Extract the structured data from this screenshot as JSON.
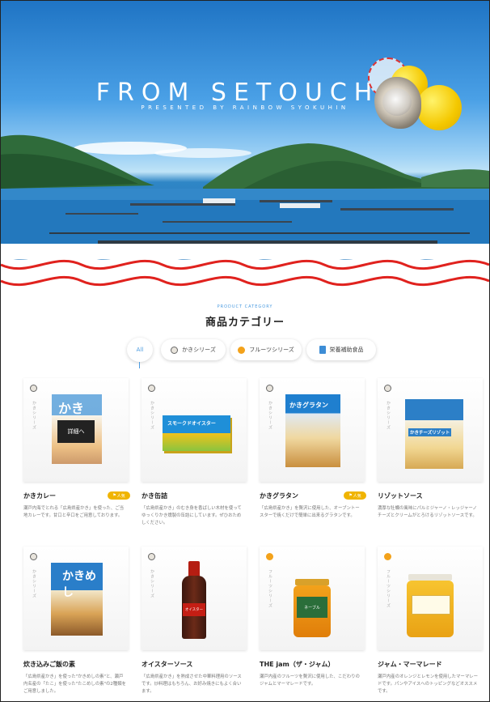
{
  "hero": {
    "title": "FROM SETOUCHI",
    "subtitle": "PRESENTED BY RAINBOW SYOKUHIN"
  },
  "category": {
    "eyebrow": "PRODUCT CATEGORY",
    "title": "商品カテゴリー"
  },
  "filters": [
    {
      "label": "All",
      "icon": "none",
      "active": true
    },
    {
      "label": "かきシリーズ",
      "icon": "oyster-shell-icon"
    },
    {
      "label": "フルーツシリーズ",
      "icon": "fruit-icon"
    },
    {
      "label": "栄養補助食品",
      "icon": "package-icon"
    }
  ],
  "products": [
    {
      "name": "かきカレー",
      "badge": "人気",
      "detail_button": "詳細へ",
      "series": "かきシリーズ",
      "desc": "瀬戸内海でとれる「広島県産かき」を使った、ご当地カレーです。甘口と辛口をご用意しております。"
    },
    {
      "name": "かき缶詰",
      "badge": "",
      "series": "かきシリーズ",
      "desc": "「広島県産かき」のむき身を香ばしい木材を使ってゆっくりかき燻製の缶詰にしています。ぜひおためしください。"
    },
    {
      "name": "かきグラタン",
      "badge": "人気",
      "series": "かきシリーズ",
      "desc": "「広島県産かき」を贅沢に使用した、オーブントースターで焼くだけで簡単に出来るグラタンです。"
    },
    {
      "name": "リゾットソース",
      "badge": "",
      "series": "かきシリーズ",
      "desc": "濃厚な牡蠣の風味にパルミジャーノ・レッジャーノチーズとクリームがとろけるリゾットソースです。"
    },
    {
      "name": "炊き込みご飯の素",
      "badge": "",
      "series": "かきシリーズ",
      "desc": "「広島県産かき」を使った\"かきめしの素\"と、瀬戸内名産の「たこ」を使った\"たこめしの素\"の2種類をご用意しました。"
    },
    {
      "name": "オイスターソース",
      "badge": "",
      "series": "かきシリーズ",
      "desc": "「広島県産かき」を熟成させた中華料理用のソースです。炒料理はもちろん、お好み焼きにもよく合います。"
    },
    {
      "name": "THE jam（ザ・ジャム）",
      "badge": "",
      "series": "フルーツシリーズ",
      "desc": "瀬戸内産のフルーツを贅沢に使用した、こだわりのジャムとマーマレードです。"
    },
    {
      "name": "ジャム・マーマレード",
      "badge": "",
      "series": "フルーツシリーズ",
      "desc": "瀬戸内産のオレンジとレモンを使用したマーマレードです。パンやアイスへのトッピングなどオススメです。"
    }
  ],
  "package_labels": {
    "curry": "かき",
    "canned": "スモークドオイスター",
    "gratin": "かきグラタン",
    "risotto": "かきチーズリゾット",
    "rice": "かきめし",
    "sauce": "オイスター",
    "jam": "ネーブル"
  },
  "colors": {
    "accent": "#4b9be0",
    "wave": "#e0221e",
    "badge": "#f0b400"
  }
}
